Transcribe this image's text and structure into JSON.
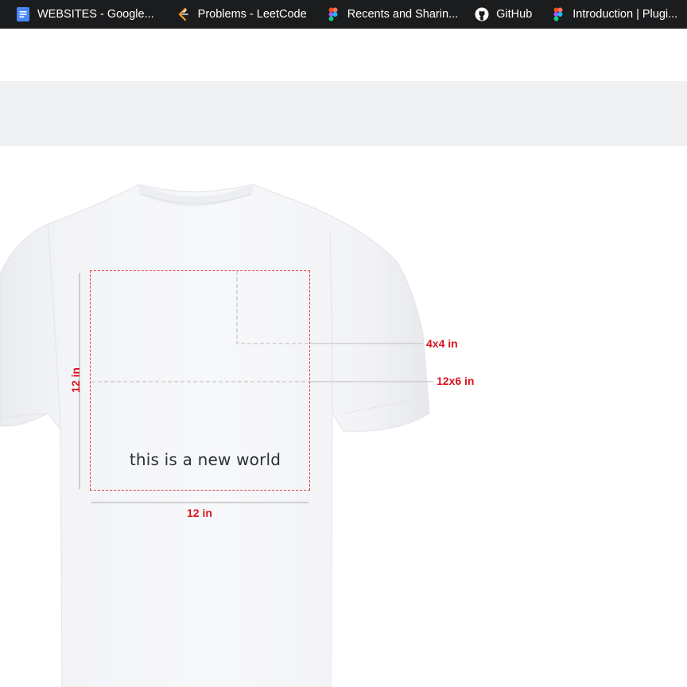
{
  "bookmarks": [
    {
      "label": "WEBSITES - Google...",
      "icon": "google-docs-icon",
      "color": "#4a86f6"
    },
    {
      "label": "Problems - LeetCode",
      "icon": "leetcode-icon",
      "color": "#f89f1b"
    },
    {
      "label": "Recents and Sharin...",
      "icon": "figma-icon",
      "color": "#f24e1e"
    },
    {
      "label": "GitHub",
      "icon": "github-icon",
      "color": "#ffffff"
    },
    {
      "label": "Introduction | Plugi...",
      "icon": "figma-icon",
      "color": "#f24e1e"
    }
  ],
  "product": {
    "shirt_color": "#ffffff",
    "design_text": "this is a new world"
  },
  "dimensions": {
    "pocket": "4x4 in",
    "half": "12x6 in",
    "height": "12 in",
    "width": "12 in"
  },
  "colors": {
    "dim_label": "#d9141f",
    "print_border": "#e23b3b",
    "guide_line": "#c7c7c7"
  }
}
